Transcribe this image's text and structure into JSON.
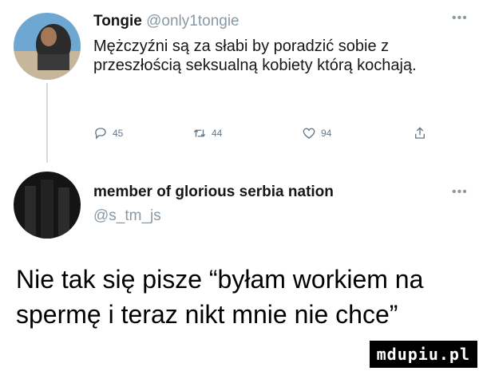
{
  "tweet1": {
    "display_name": "Tongie",
    "handle": "@only1tongie",
    "text": "Mężczyźni są za słabi by poradzić sobie z przeszłością seksualną kobiety którą kochają.",
    "more_icon": "ellipsis-icon",
    "actions": {
      "reply_count": "45",
      "retweet_count": "44",
      "like_count": "94"
    }
  },
  "tweet2": {
    "display_name": "member of glorious serbia nation",
    "handle": "@s_tm_js",
    "more_icon": "ellipsis-icon"
  },
  "caption": "Nie tak się pisze “byłam workiem na spermę i teraz nikt mnie nie chce”",
  "watermark": "mdupiu.pl",
  "colors": {
    "text": "#14171a",
    "muted": "#8899a6",
    "background": "#ffffff"
  }
}
